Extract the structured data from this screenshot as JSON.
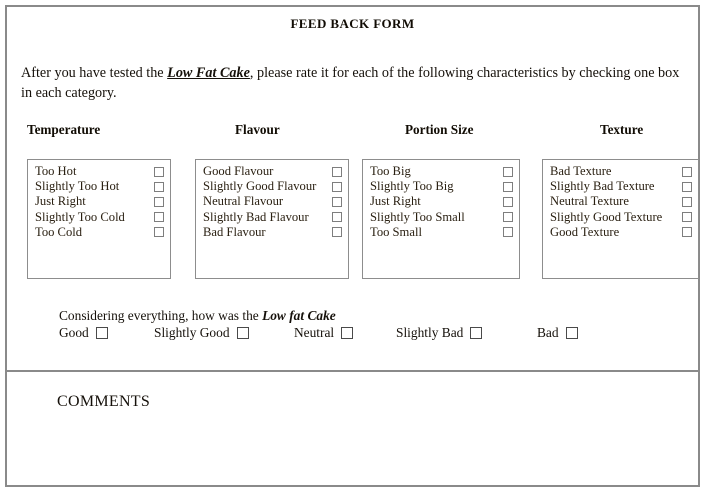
{
  "form": {
    "title": "FEED BACK FORM",
    "intro": {
      "before": "After you have tested the ",
      "product": "Low Fat Cake",
      "after": ", please rate it for each of the following characteristics by checking one box in each category."
    },
    "categories": [
      {
        "header": "Temperature",
        "options": [
          "Too Hot",
          "Slightly Too Hot",
          "Just Right",
          "Slightly Too Cold",
          "Too Cold"
        ]
      },
      {
        "header": "Flavour",
        "options": [
          "Good Flavour",
          "Slightly Good Flavour",
          "Neutral Flavour",
          "Slightly Bad Flavour",
          "Bad Flavour"
        ]
      },
      {
        "header": "Portion Size",
        "options": [
          "Too Big",
          "Slightly Too Big",
          "Just Right",
          "Slightly Too Small",
          "Too Small"
        ]
      },
      {
        "header": "Texture",
        "options": [
          "Bad Texture",
          "Slightly Bad Texture",
          "Neutral Texture",
          "Slightly Good Texture",
          "Good Texture"
        ]
      }
    ],
    "overall": {
      "question_before": "Considering everything, how was the ",
      "question_product": "Low fat Cake",
      "options": [
        "Good",
        "Slightly Good",
        "Neutral",
        "Slightly Bad",
        "Bad"
      ]
    },
    "comments_label": "COMMENTS"
  },
  "colors": {
    "frame_border": "#8a8a8a",
    "box_border": "#8d8d8d",
    "checkbox_border": "#7e7e7e",
    "text": "#15100a",
    "option_text": "#2a2012",
    "background": "#ffffff"
  }
}
